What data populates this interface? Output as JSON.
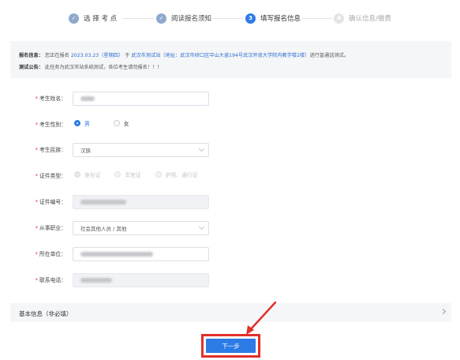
{
  "stepper": {
    "steps": [
      {
        "label": "选 择 考 点",
        "state": "done",
        "num": "✓"
      },
      {
        "label": "阅读报名须知",
        "state": "done",
        "num": "✓"
      },
      {
        "label": "填写报名信息",
        "state": "active",
        "num": "3"
      },
      {
        "label": "确认信息/缴费",
        "state": "todo",
        "num": "4"
      }
    ]
  },
  "banner": {
    "info_key": "报名信息：",
    "info_pre": "您正在报名",
    "info_date": "2023.03.23（星期四）",
    "info_mid": "于",
    "info_site": "武汉市测试站（地址：武汉市硚口区中山大道194号武汉开放大学院内教学楼2楼）",
    "info_post": "进行普通话测试。",
    "notice_key": "测试公告：",
    "notice_text": "此任务为武汉市站系统测试，各位考生请勿报名！！！"
  },
  "form": {
    "name_label": "考生姓名：",
    "gender_label": "考生性别：",
    "gender_male": "男",
    "gender_female": "女",
    "ethnicity_label": "考生民族：",
    "ethnicity_value": "汉族",
    "idtype_label": "证件类型：",
    "idtype_opt1": "身份证",
    "idtype_opt2": "军官证",
    "idtype_opt3": "护照、通行证",
    "idnum_label": "证件编号：",
    "job_label": "从事职业：",
    "job_value": "社会其他人员 / 其他",
    "unit_label": "所在单位：",
    "phone_label": "联系电话："
  },
  "section": {
    "title": "基本信息（非必填）"
  },
  "next_button": {
    "label": "下一步"
  },
  "colors": {
    "primary": "#2d7be5",
    "highlight_box": "#e0302a",
    "required": "#e33333"
  }
}
